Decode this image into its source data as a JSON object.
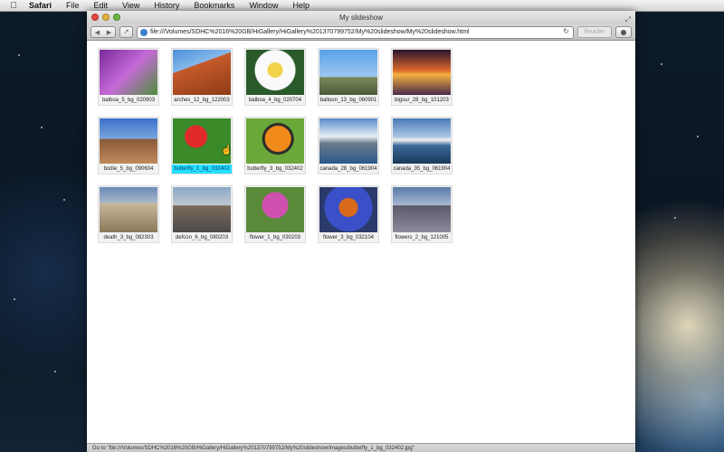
{
  "menubar": {
    "apple_icon": "apple-icon",
    "items": [
      "Safari",
      "File",
      "Edit",
      "View",
      "History",
      "Bookmarks",
      "Window",
      "Help"
    ]
  },
  "window": {
    "title": "My slideshow",
    "url": "file:///Volumes/SDHC%2016%20GB/HiGallery/HiGallery%201370799752/My%20slideshow/My%20slideshow.html",
    "reader_label": "Reader",
    "status_text": "Go to \"file:///Volumes/SDHC%2016%20GB/HiGallery/HiGallery%201370799752/My%20slideshow/images/butterfly_1_bg_032402.jpg\""
  },
  "gallery": {
    "rows": [
      [
        {
          "caption": "balboa_5_bg_020903"
        },
        {
          "caption": "arches_12_bg_122003"
        },
        {
          "caption": "balboa_4_bg_020704"
        },
        {
          "caption": "balloon_13_bg_060901"
        },
        {
          "caption": "bigsur_28_bg_101203"
        }
      ],
      [
        {
          "caption": "bodie_5_bg_090604"
        },
        {
          "caption": "butterfly_1_bg_032402",
          "selected": true
        },
        {
          "caption": "butterfly_3_bg_032402"
        },
        {
          "caption": "canada_28_bg_061904"
        },
        {
          "caption": "canada_35_bg_061904"
        }
      ],
      [
        {
          "caption": "death_3_bg_082303"
        },
        {
          "caption": "defcon_6_bg_080203"
        },
        {
          "caption": "flower_1_bg_030203"
        },
        {
          "caption": "flower_3_bg_032104"
        },
        {
          "caption": "flowers_2_bg_121005"
        }
      ]
    ]
  }
}
